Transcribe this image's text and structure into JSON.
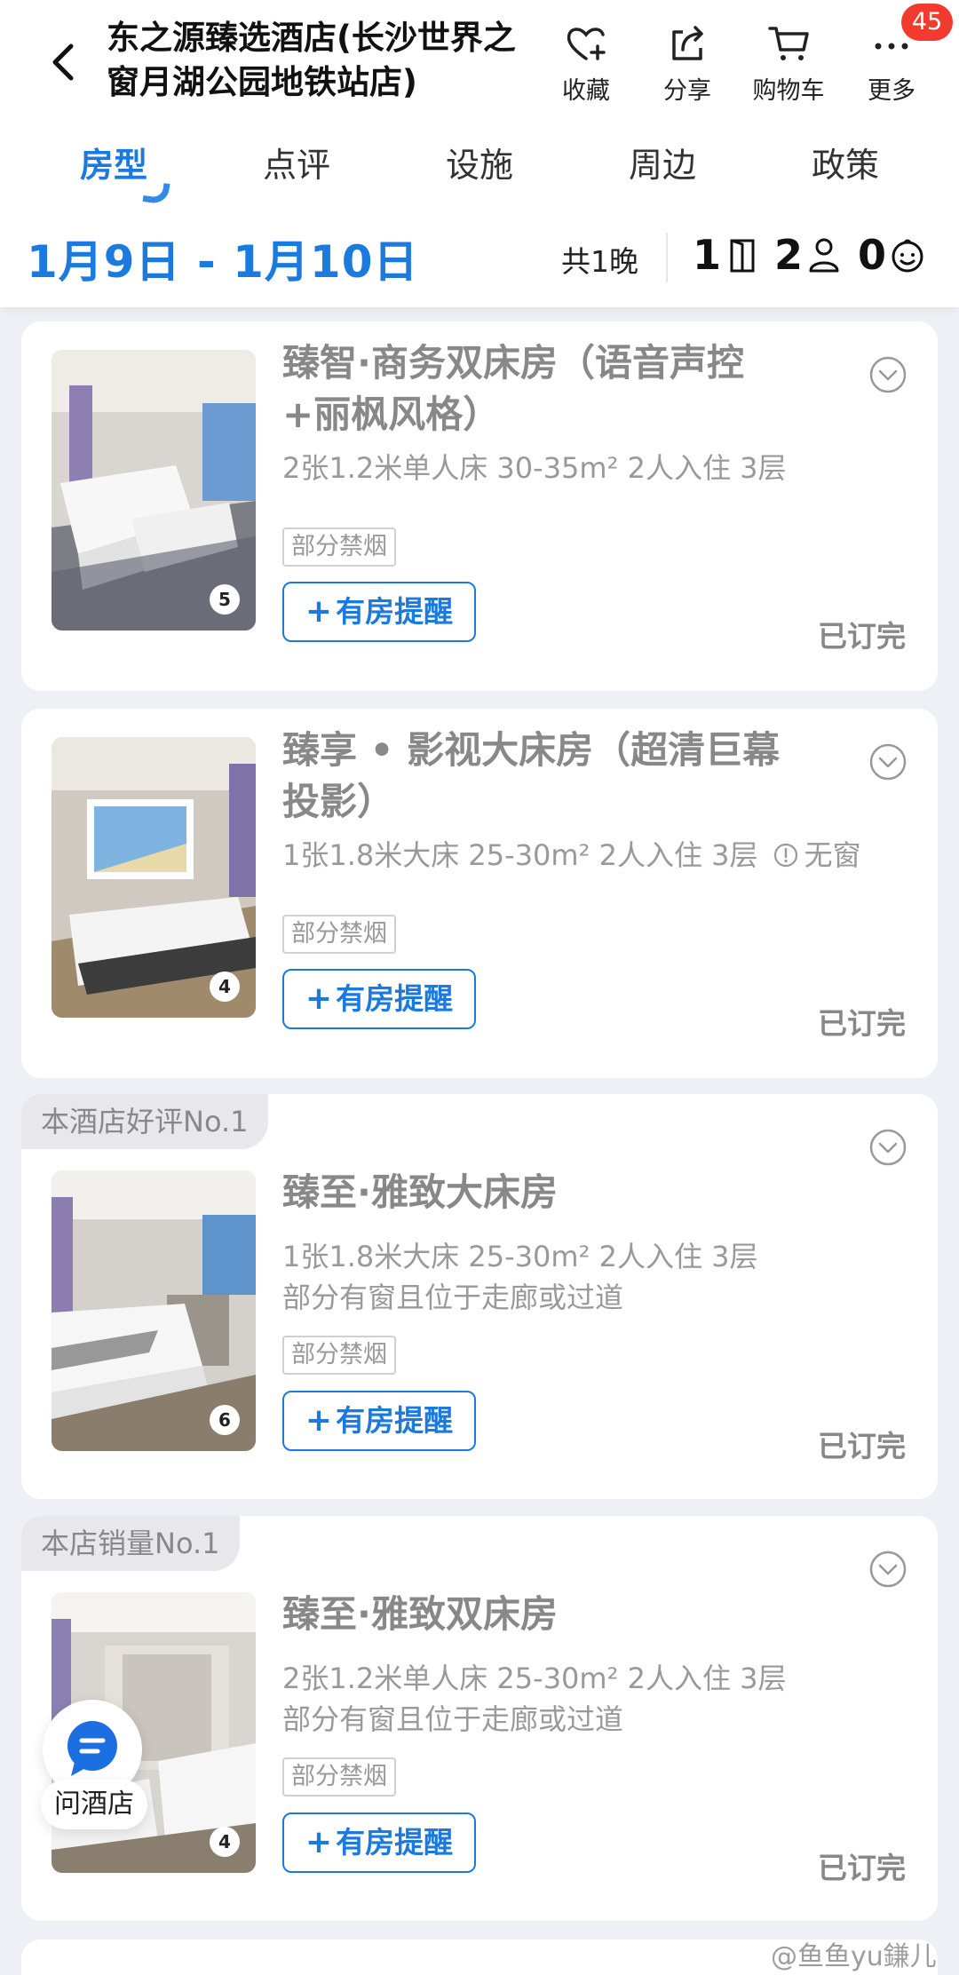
{
  "header": {
    "hotel_name": "东之源臻选酒店(长沙世界之窗月湖公园地铁站店)",
    "actions": {
      "favorite": "收藏",
      "share": "分享",
      "cart": "购物车",
      "more": "更多"
    },
    "badge_count": "45",
    "tabs": [
      "房型",
      "点评",
      "设施",
      "周边",
      "政策"
    ],
    "active_tab": "房型",
    "date_range": "1月9日 - 1月10日",
    "nights": "共1晚",
    "rooms": "1",
    "adults": "2",
    "children": "0"
  },
  "rooms": [
    {
      "rank_tag": "",
      "name_line1": "臻智·商务双床房（语音声控",
      "name_line2": "+丽枫风格）",
      "spec": "2张1.2米单人床 30-35m² 2人入住 3层",
      "spec2": "",
      "warning": "",
      "smoke_tag": "部分禁烟",
      "alert_label": "有房提醒",
      "status": "已订完",
      "photo_count": "5"
    },
    {
      "rank_tag": "",
      "name_line1": "臻享 • 影视大床房（超清巨幕",
      "name_line2": "投影）",
      "spec": "1张1.8米大床 25-30m² 2人入住 3层",
      "spec2": "",
      "warning": "无窗",
      "smoke_tag": "部分禁烟",
      "alert_label": "有房提醒",
      "status": "已订完",
      "photo_count": "4"
    },
    {
      "rank_tag": "本酒店好评No.1",
      "name_line1": "臻至·雅致大床房",
      "name_line2": "",
      "spec": "1张1.8米大床 25-30m² 2人入住 3层",
      "spec2": "部分有窗且位于走廊或过道",
      "warning": "",
      "smoke_tag": "部分禁烟",
      "alert_label": "有房提醒",
      "status": "已订完",
      "photo_count": "6"
    },
    {
      "rank_tag": "本店销量No.1",
      "name_line1": "臻至·雅致双床房",
      "name_line2": "",
      "spec": "2张1.2米单人床 25-30m² 2人入住 3层",
      "spec2": "部分有窗且位于走廊或过道",
      "warning": "",
      "smoke_tag": "部分禁烟",
      "alert_label": "有房提醒",
      "status": "已订完",
      "photo_count": "4"
    }
  ],
  "chat_fab": {
    "label": "问酒店"
  },
  "watermark": "@鱼鱼yu鎌儿",
  "colors": {
    "accent": "#1c7adf",
    "badge": "#f23a2f",
    "background": "#eef0f5"
  }
}
